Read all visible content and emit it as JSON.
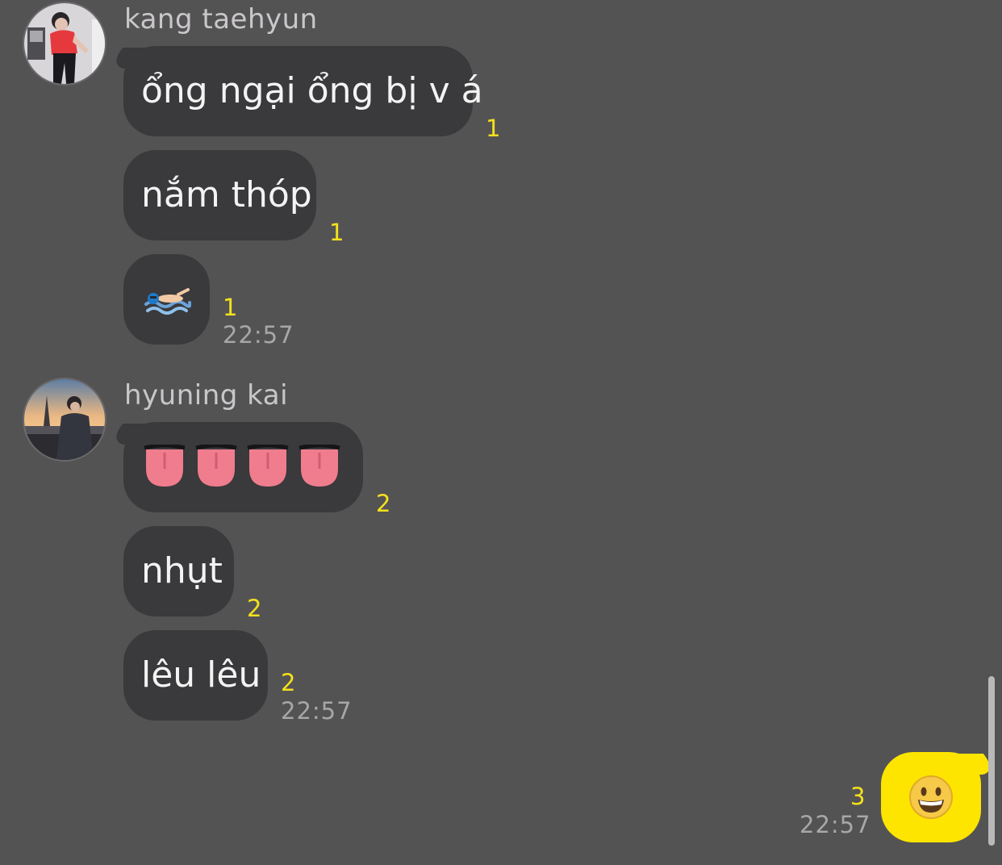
{
  "messages": [
    {
      "sender": "kang taehyun",
      "bubbles": [
        {
          "text": "ổng ngại ổng bị v á",
          "read": "1"
        },
        {
          "text": "nắm thóp",
          "read": "1"
        },
        {
          "emoji": "swimmer",
          "read": "1",
          "time": "22:57"
        }
      ]
    },
    {
      "sender": "hyuning kai",
      "bubbles": [
        {
          "emoji": "tongue x4",
          "read": "2"
        },
        {
          "text": "nhụt",
          "read": "2"
        },
        {
          "text": "lêu lêu",
          "read": "2",
          "time": "22:57"
        }
      ]
    }
  ],
  "mine": {
    "emoji": "grinning face",
    "read": "3",
    "time": "22:57"
  },
  "colors": {
    "background": "#545354",
    "bubble_other": "#3a393b",
    "bubble_mine": "#fde500",
    "read_count": "#f5e11b",
    "timestamp": "#a8a6a9"
  }
}
